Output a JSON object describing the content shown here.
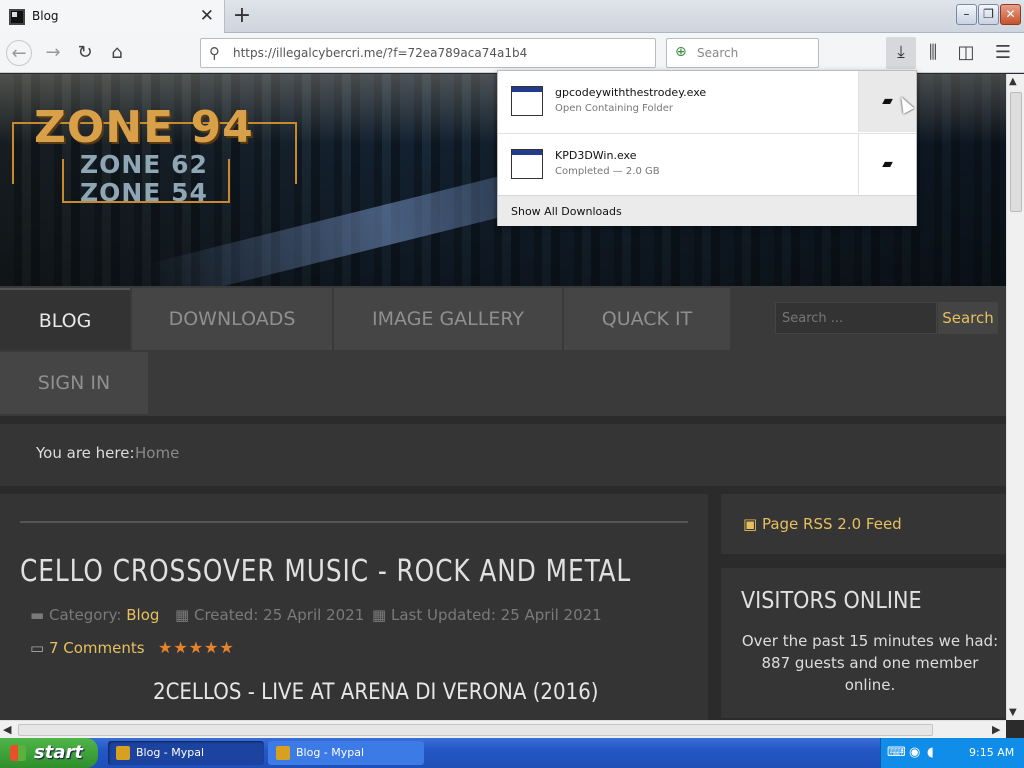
{
  "browser": {
    "tab_title": "Blog",
    "url": "https://illegalcybercri.me/?f=72ea789aca74a1b4",
    "search_placeholder": "Search",
    "tab_close": "✕",
    "new_tab": "+"
  },
  "downloads": {
    "items": [
      {
        "filename": "gpcodeywiththestrodey.exe",
        "status": "Open Containing Folder"
      },
      {
        "filename": "KPD3DWin.exe",
        "status": "Completed — 2.0 GB"
      }
    ],
    "show_all": "Show All Downloads"
  },
  "site": {
    "logo": {
      "main": "ZONE 94",
      "sub1": "ZONE 62",
      "sub2": "ZONE 54"
    },
    "nav": [
      "BLOG",
      "DOWNLOADS",
      "IMAGE GALLERY",
      "QUACK IT",
      "SIGN IN"
    ],
    "search": {
      "placeholder": "Search ...",
      "button": "Search"
    },
    "breadcrumb": {
      "label": "You are here:",
      "current": "Home"
    }
  },
  "article": {
    "title": "CELLO CROSSOVER MUSIC - ROCK AND METAL",
    "category_label": "Category:",
    "category": "Blog",
    "created": "Created: 25 April 2021",
    "updated": "Last Updated: 25 April 2021",
    "comments": "7 Comments",
    "rating": 5,
    "stars": "★★★★★",
    "subtitle": "2CELLOS - LIVE AT ARENA DI VERONA (2016)"
  },
  "sidebar": {
    "rss": "Page RSS 2.0 Feed",
    "visitors_title": "VISITORS ONLINE",
    "visitors_text": "Over the past 15 minutes we had: 887 guests and one member online."
  },
  "taskbar": {
    "start": "start",
    "tasks": [
      "Blog - Mypal",
      "Blog - Mypal"
    ],
    "clock": "9:15 AM"
  },
  "colors": {
    "accent": "#e6c060",
    "star": "#e6832a",
    "taskbar": "#2457c5"
  }
}
